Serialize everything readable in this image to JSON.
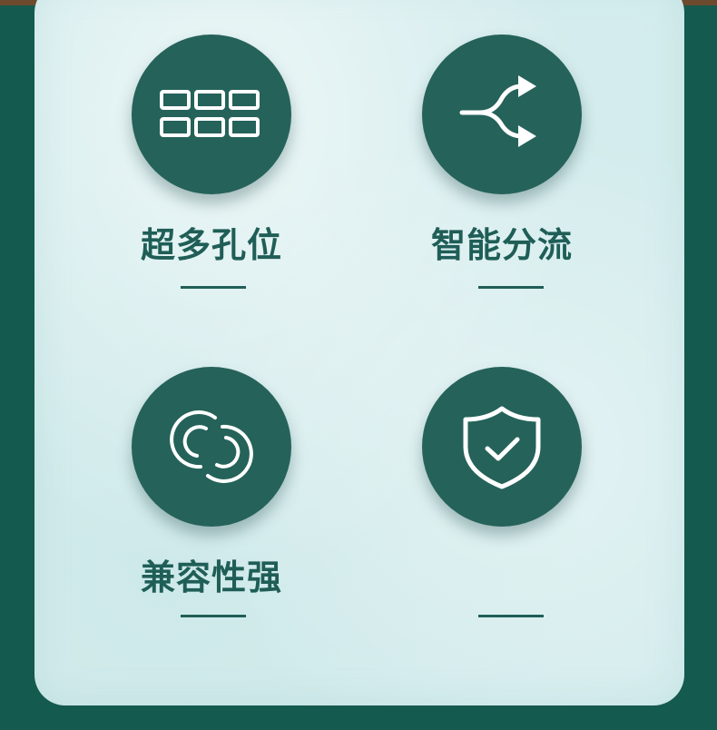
{
  "features": [
    {
      "label": "超多孔位",
      "icon": "grid-slots-icon"
    },
    {
      "label": "智能分流",
      "icon": "split-arrows-icon"
    },
    {
      "label": "兼容性强",
      "icon": "linked-rings-icon"
    },
    {
      "label": "",
      "icon": "shield-check-icon"
    }
  ],
  "colors": {
    "background": "#145a4e",
    "panel": "#d4eced",
    "circle": "#25625a",
    "text": "#1f5e57"
  }
}
